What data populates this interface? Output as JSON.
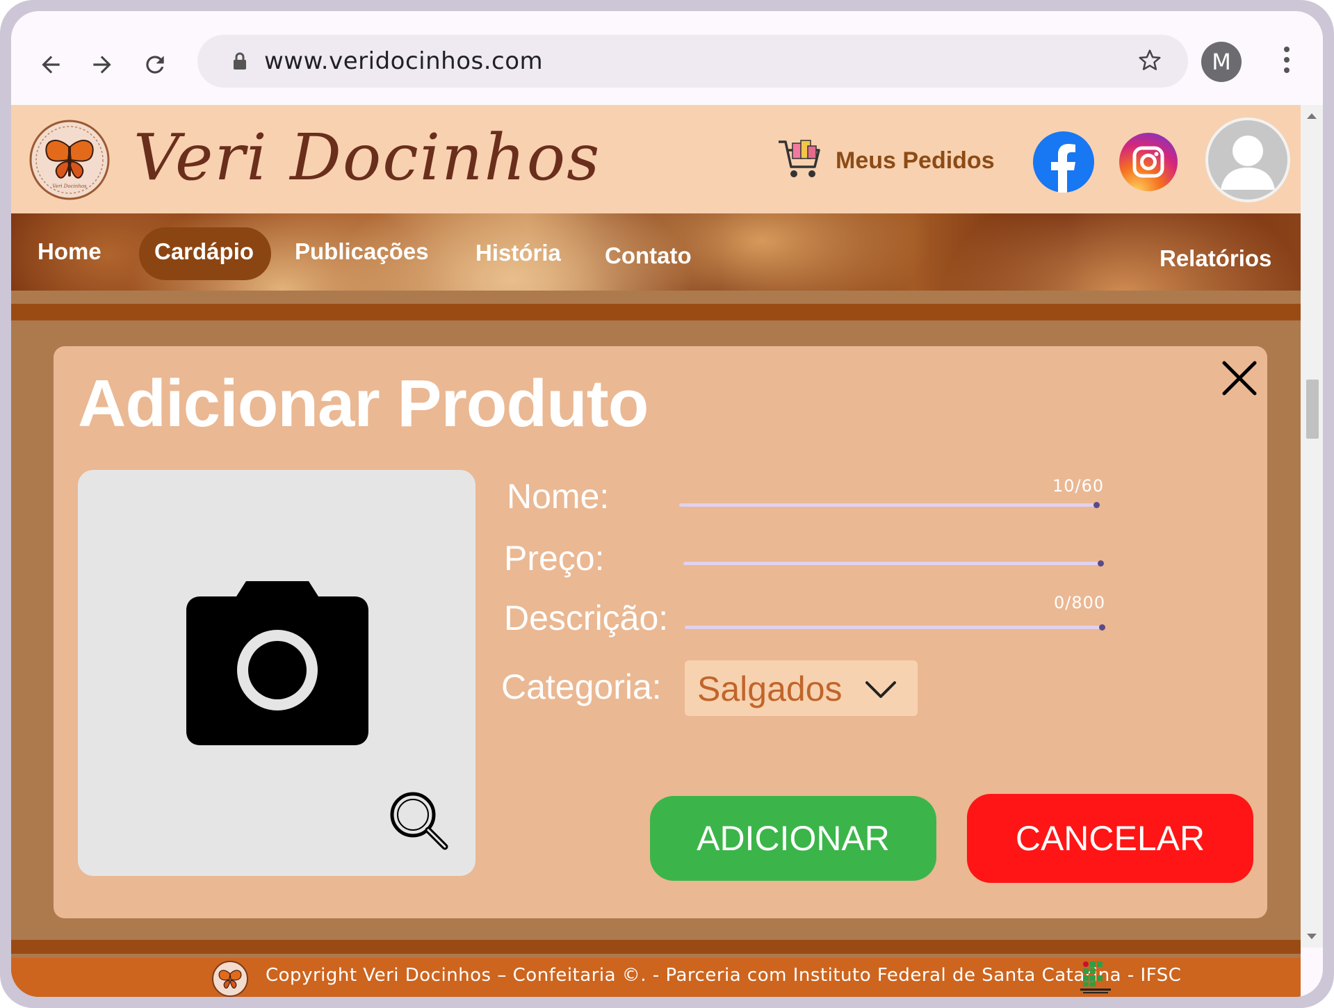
{
  "browser": {
    "url": "www.veridocinhos.com",
    "profile_initial": "M"
  },
  "site": {
    "brand": "Veri Docinhos",
    "orders_label": "Meus Pedidos",
    "nav": {
      "home": "Home",
      "cardapio": "Cardápio",
      "publicacoes": "Publicações",
      "historia": "História",
      "contato": "Contato",
      "relatorios": "Relatórios"
    },
    "active_nav": "Cardápio"
  },
  "modal": {
    "title": "Adicionar Produto",
    "fields": {
      "nome_label": "Nome:",
      "nome_value": "",
      "nome_counter": "10/60",
      "preco_label": "Preço:",
      "preco_value": "",
      "descricao_label": "Descrição:",
      "descricao_value": "",
      "descricao_counter": "0/800",
      "categoria_label": "Categoria:",
      "categoria_value": "Salgados"
    },
    "add_button": "ADICIONAR",
    "cancel_button": "CANCELAR"
  },
  "footer": {
    "text": "Copyright Veri Docinhos – Confeitaria ©. - Parceria com Instituto Federal de Santa Catarina - IFSC"
  },
  "colors": {
    "header_bg": "#f8d1b0",
    "page_bg": "#ad7a4e",
    "modal_bg": "#eab893",
    "add_green": "#3bb54a",
    "cancel_red": "#ff1515",
    "footer_bg": "#cd651f",
    "nav_active": "#8b4513"
  },
  "icons": [
    "back-arrow-icon",
    "forward-arrow-icon",
    "reload-icon",
    "lock-icon",
    "star-icon",
    "kebab-menu-icon",
    "butterfly-logo-icon",
    "shopping-cart-icon",
    "facebook-icon",
    "instagram-icon",
    "user-avatar-icon",
    "close-icon",
    "camera-icon",
    "magnifier-icon",
    "chevron-down-icon",
    "ifsc-logo-icon"
  ]
}
